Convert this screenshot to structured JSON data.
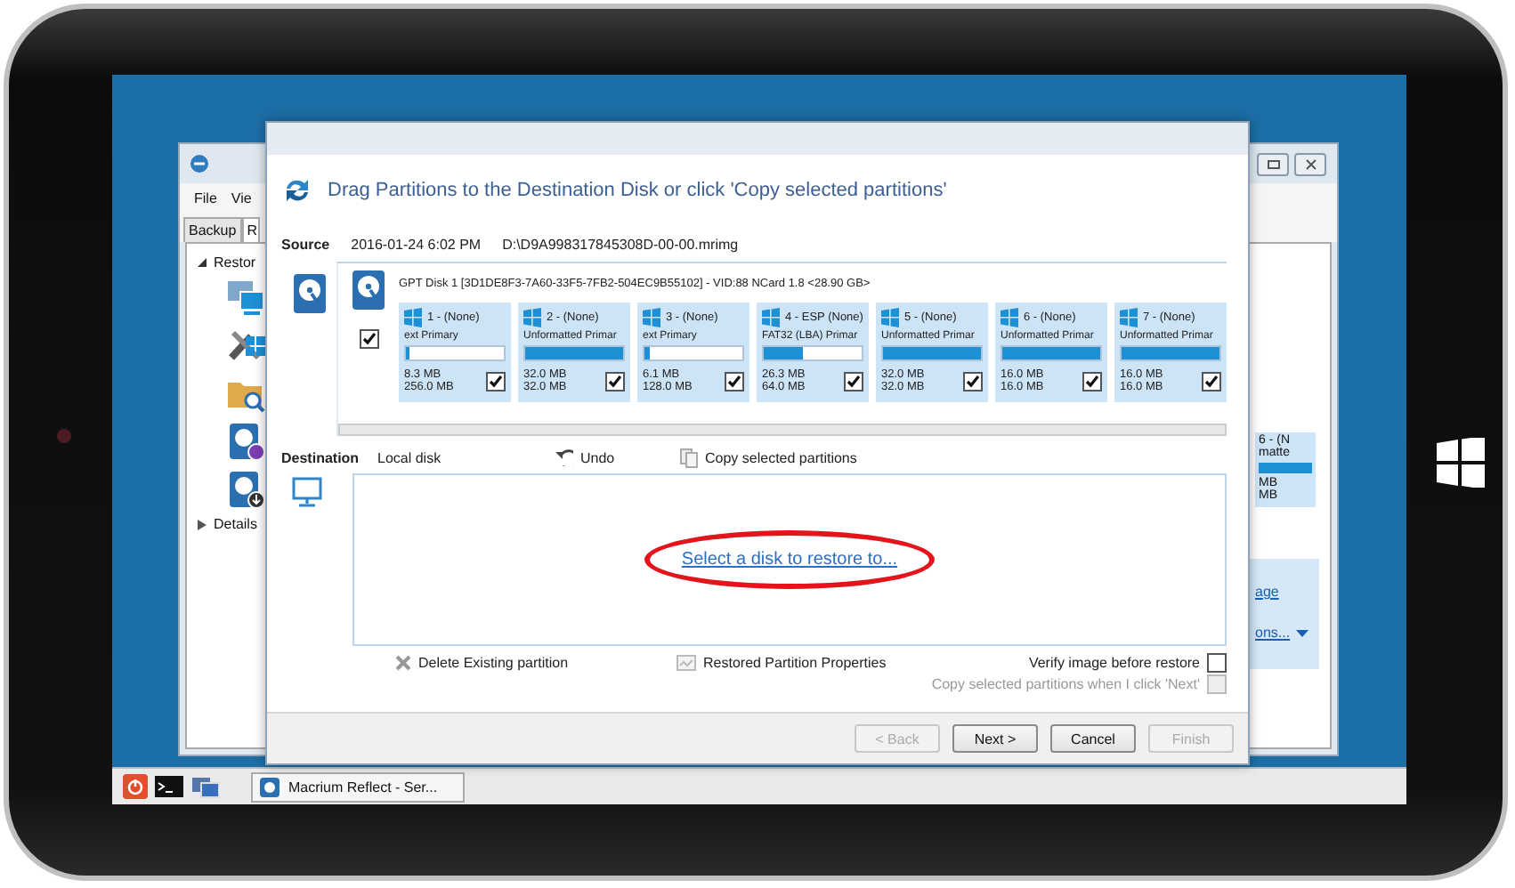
{
  "background_window": {
    "menu": [
      "File",
      "Vie"
    ],
    "tabs": [
      {
        "label": "Backup",
        "selected": false
      },
      {
        "label": "R",
        "selected": true
      }
    ],
    "tree": [
      {
        "label": "Restor",
        "expanded": true
      },
      {
        "label": "Details",
        "expanded": false
      }
    ],
    "partition_fragment": {
      "name": "6 - (N",
      "type": "matte",
      "used": "MB",
      "total": "MB"
    },
    "links": [
      "age",
      "ons..."
    ]
  },
  "dialog": {
    "header": "Drag Partitions to the Destination Disk or click 'Copy selected partitions'",
    "source": {
      "label": "Source",
      "date": "2016-01-24 6:02 PM",
      "path": "D:\\D9A998317845308D-00-00.mrimg"
    },
    "disk": {
      "title": "GPT Disk 1 [3D1DE8F3-7A60-33F5-7FB2-504EC9B55102] - VID:88 NCard 1.8  <28.90 GB>",
      "checked": true
    },
    "partitions": [
      {
        "name": "1 - (None)",
        "type": "ext Primary",
        "level": 0.03,
        "used": "8.3 MB",
        "total": "256.0 MB",
        "checked": true
      },
      {
        "name": "2 - (None)",
        "type": "Unformatted Primar",
        "level": 1,
        "used": "32.0 MB",
        "total": "32.0 MB",
        "checked": true
      },
      {
        "name": "3 - (None)",
        "type": "ext Primary",
        "level": 0.05,
        "used": "6.1 MB",
        "total": "128.0 MB",
        "checked": true
      },
      {
        "name": "4 - ESP (None)",
        "type": "FAT32 (LBA) Primar",
        "level": 0.4,
        "used": "26.3 MB",
        "total": "64.0 MB",
        "checked": true
      },
      {
        "name": "5 - (None)",
        "type": "Unformatted Primar",
        "level": 1,
        "used": "32.0 MB",
        "total": "32.0 MB",
        "checked": true
      },
      {
        "name": "6 - (None)",
        "type": "Unformatted Primar",
        "level": 1,
        "used": "16.0 MB",
        "total": "16.0 MB",
        "checked": true
      },
      {
        "name": "7 - (None)",
        "type": "Unformatted Primar",
        "level": 1,
        "used": "16.0 MB",
        "total": "16.0 MB",
        "checked": true
      }
    ],
    "destination": {
      "label": "Destination",
      "disk": "Local disk",
      "undo": "Undo",
      "copy": "Copy selected partitions"
    },
    "select_link": {
      "label": "Select a disk to restore to...",
      "highlighted": true
    },
    "actions": {
      "delete": "Delete Existing partition",
      "properties": "Restored Partition Properties"
    },
    "options": [
      {
        "label": "Verify image before restore",
        "checked": false,
        "disabled": false
      },
      {
        "label": "Copy selected partitions when I click 'Next'",
        "checked": false,
        "disabled": true
      }
    ],
    "buttons": [
      {
        "label": "< Back",
        "disabled": true
      },
      {
        "label": "Next >",
        "disabled": false
      },
      {
        "label": "Cancel",
        "disabled": false
      },
      {
        "label": "Finish",
        "disabled": true
      }
    ]
  },
  "taskbar": {
    "tasks": [
      "Macrium Reflect - Ser..."
    ]
  }
}
